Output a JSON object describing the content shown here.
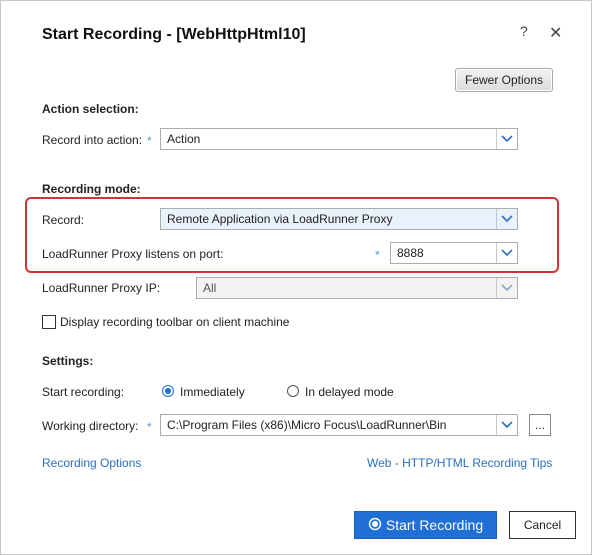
{
  "dialog": {
    "title": "Start Recording - [WebHttpHtml10]",
    "help_glyph": "?",
    "close_glyph": "✕"
  },
  "toolbar": {
    "fewer_options_label": "Fewer Options"
  },
  "action_selection": {
    "heading": "Action selection:",
    "record_into_label": "Record into action:",
    "required_mark": "*",
    "record_into_value": "Action"
  },
  "recording_mode": {
    "heading": "Recording mode:",
    "record_label": "Record:",
    "record_value": "Remote Application via LoadRunner Proxy",
    "port_label": "LoadRunner Proxy listens on port:",
    "port_required_mark": "*",
    "port_value": "8888",
    "ip_label": "LoadRunner Proxy IP:",
    "ip_value": "All",
    "toolbar_checkbox_label": "Display recording toolbar on client machine",
    "toolbar_checkbox_checked": false
  },
  "settings": {
    "heading": "Settings:",
    "start_label": "Start recording:",
    "option_immediately": "Immediately",
    "option_delayed": "In delayed mode",
    "selected_option": "Immediately",
    "working_dir_label": "Working directory:",
    "working_dir_required_mark": "*",
    "working_dir_value": "C:\\Program Files (x86)\\Micro Focus\\LoadRunner\\Bin",
    "browse_label": "..."
  },
  "links": {
    "recording_options": "Recording Options",
    "tips": "Web - HTTP/HTML Recording Tips"
  },
  "footer": {
    "start_label": "Start Recording",
    "cancel_label": "Cancel"
  },
  "colors": {
    "accent": "#1f6fd6",
    "highlight_border": "#d13434",
    "link": "#2b6fc2",
    "required": "#5b9bd5"
  },
  "icons": {
    "dropdown": "chevron-down-icon",
    "record": "record-circle-icon"
  }
}
